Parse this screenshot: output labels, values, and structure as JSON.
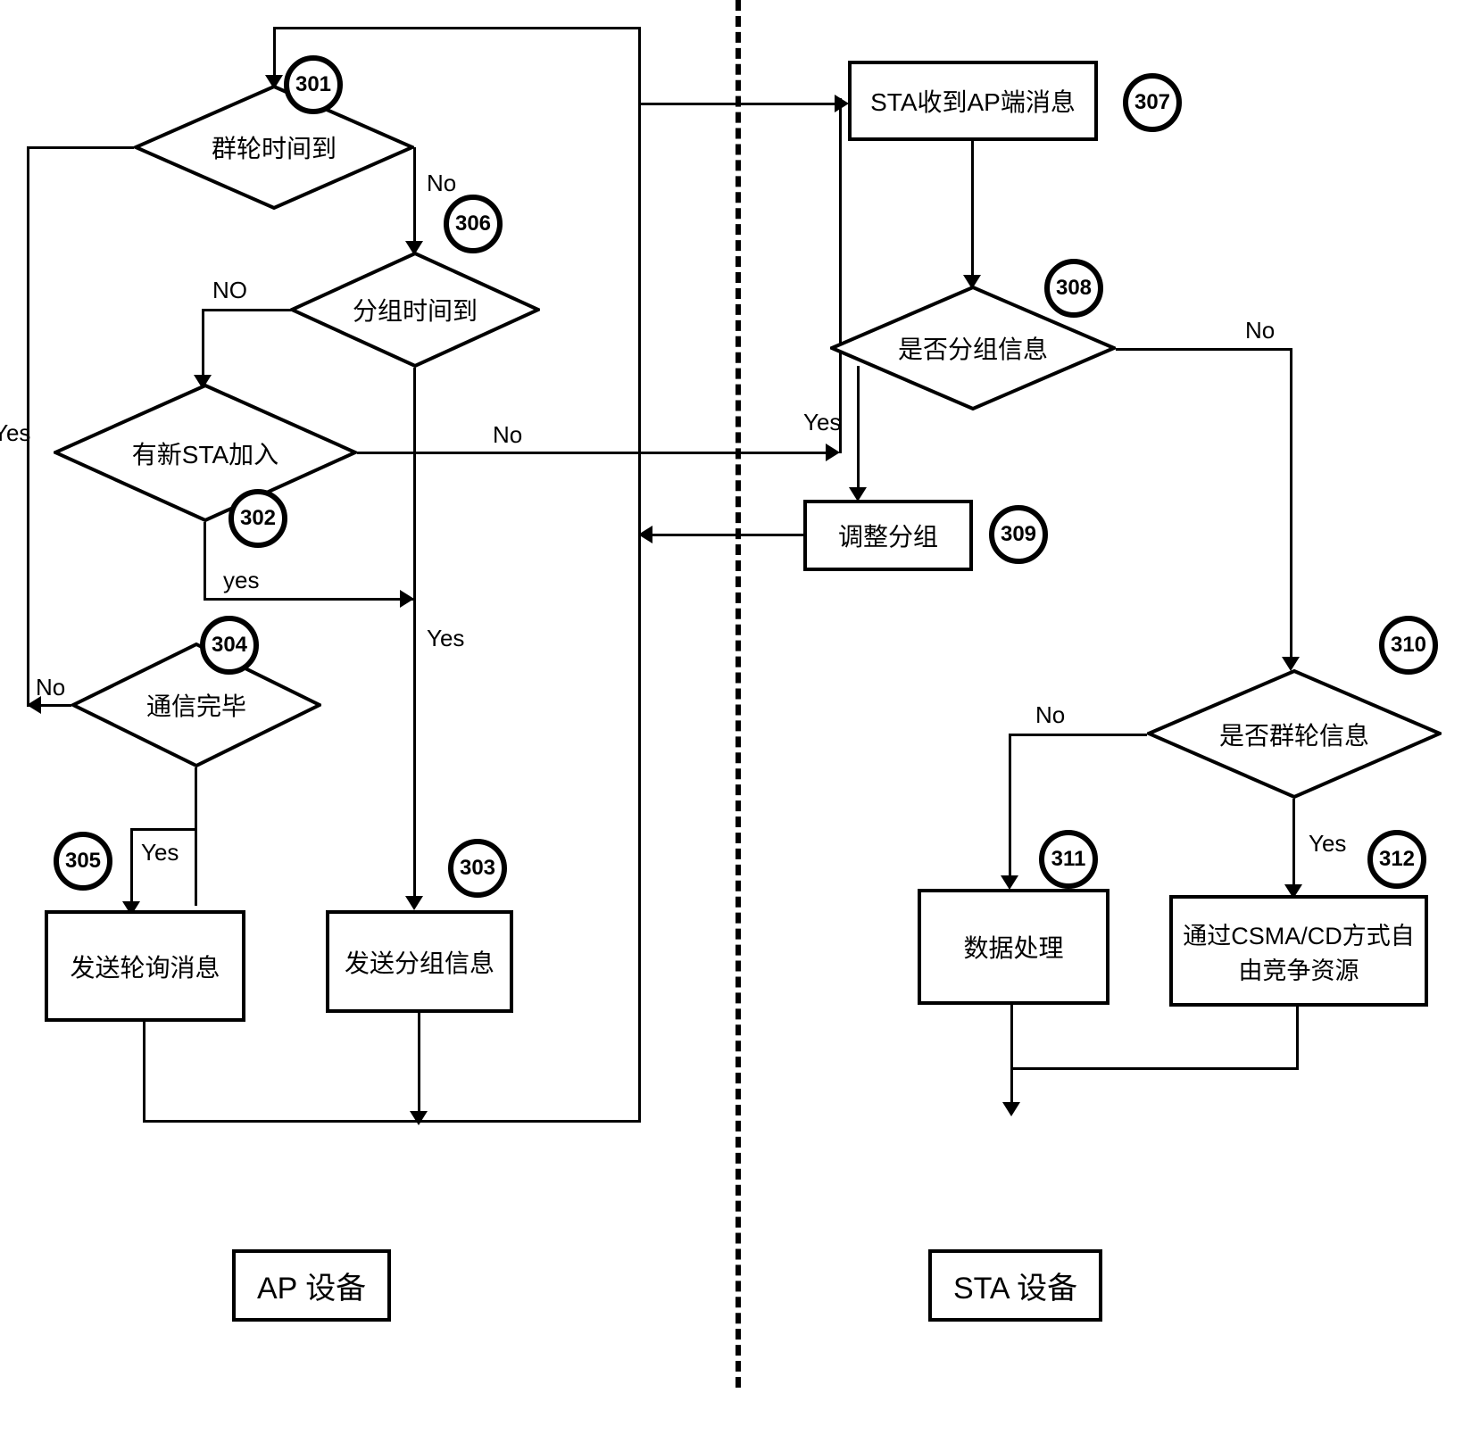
{
  "nodes": {
    "n301": {
      "text": "群轮时间到",
      "ref": "301"
    },
    "n302": {
      "text": "有新STA加入",
      "ref": "302"
    },
    "n303": {
      "text": "发送分组信息",
      "ref": "303"
    },
    "n304": {
      "text": "通信完毕",
      "ref": "304"
    },
    "n305": {
      "text": "发送轮询消息",
      "ref": "305"
    },
    "n306": {
      "text": "分组时间到",
      "ref": "306"
    },
    "n307": {
      "text": "STA收到AP端消息",
      "ref": "307"
    },
    "n308": {
      "text": "是否分组信息",
      "ref": "308"
    },
    "n309": {
      "text": "调整分组",
      "ref": "309"
    },
    "n310": {
      "text": "是否群轮信息",
      "ref": "310"
    },
    "n311": {
      "text": "数据处理",
      "ref": "311"
    },
    "n312": {
      "text": "通过CSMA/CD方式自由竞争资源",
      "ref": "312"
    }
  },
  "edge_labels": {
    "yes1": "Yes",
    "yes_l": "yes",
    "no1": "No",
    "no_u": "NO"
  },
  "devices": {
    "ap": "AP 设备",
    "sta": "STA 设备"
  }
}
